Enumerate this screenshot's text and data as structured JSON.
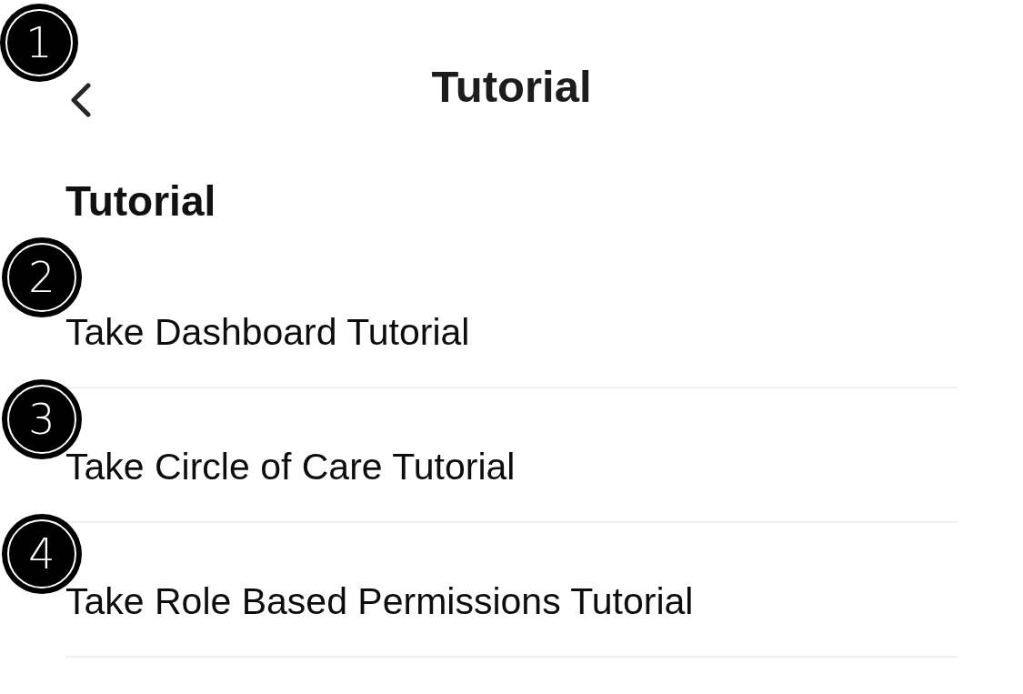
{
  "header": {
    "title": "Tutorial",
    "marker": "1"
  },
  "section": {
    "heading": "Tutorial",
    "items": [
      {
        "label": "Take Dashboard Tutorial",
        "marker": "2"
      },
      {
        "label": "Take Circle of Care Tutorial",
        "marker": "3"
      },
      {
        "label": "Take Role Based Permissions Tutorial",
        "marker": "4"
      }
    ]
  }
}
